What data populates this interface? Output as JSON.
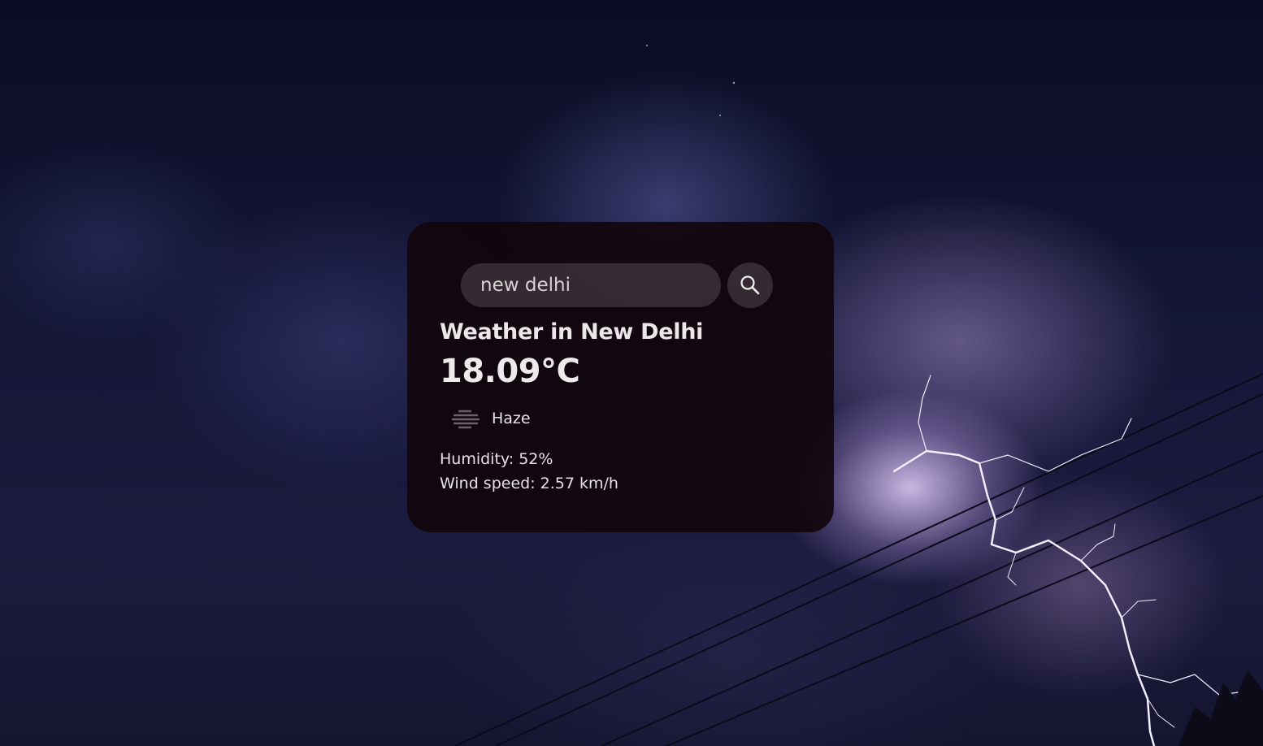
{
  "search": {
    "value": "new delhi",
    "button_icon": "search-icon"
  },
  "weather": {
    "city_heading": "Weather in New Delhi",
    "temperature": "18.09°C",
    "condition_icon": "haze-icon",
    "description": "Haze",
    "humidity": "Humidity: 52%",
    "wind_speed": "Wind speed: 2.57 km/h"
  },
  "colors": {
    "card_background": "#12060a",
    "text": "#eeeaec",
    "lightning": "#f2e6ff"
  }
}
